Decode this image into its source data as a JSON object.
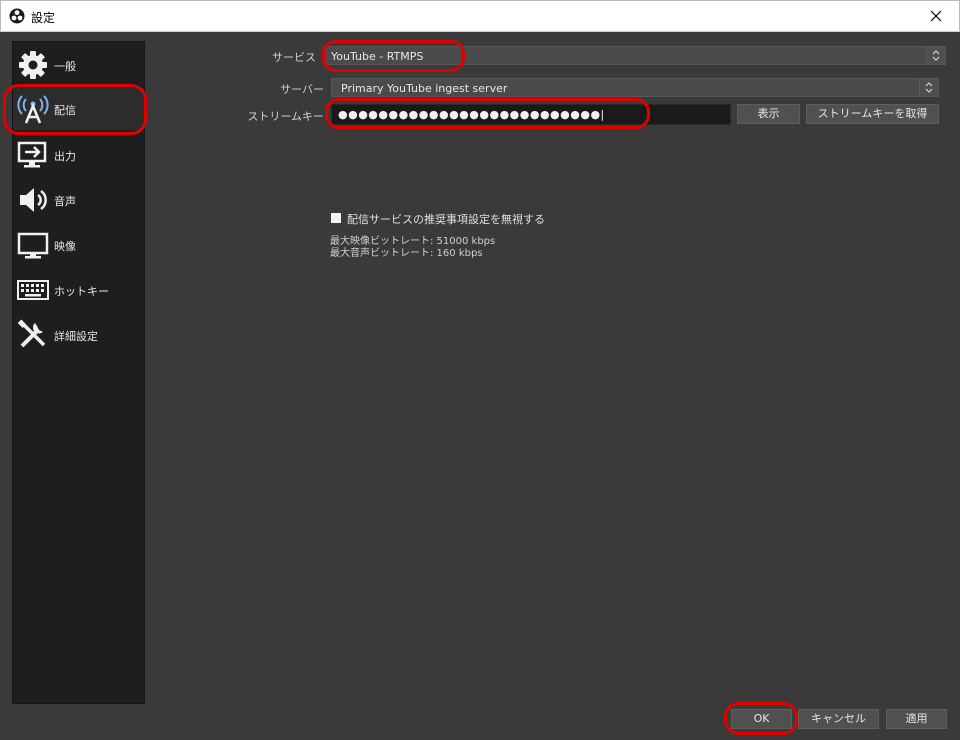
{
  "window": {
    "title": "設定"
  },
  "sidebar": {
    "items": [
      {
        "label": "一般",
        "icon": "gear-icon"
      },
      {
        "label": "配信",
        "icon": "antenna-icon",
        "selected": true
      },
      {
        "label": "出力",
        "icon": "output-icon"
      },
      {
        "label": "音声",
        "icon": "speaker-icon"
      },
      {
        "label": "映像",
        "icon": "monitor-icon"
      },
      {
        "label": "ホットキー",
        "icon": "keyboard-icon"
      },
      {
        "label": "詳細設定",
        "icon": "tools-icon"
      }
    ]
  },
  "stream": {
    "service_label": "サービス",
    "service_value": "YouTube - RTMPS",
    "server_label": "サーバー",
    "server_value": "Primary YouTube ingest server",
    "key_label": "ストリームキー",
    "key_value": "●●●●●●●●●●●●●●●●●●●●●●●●●●|",
    "show_button": "表示",
    "get_key_button": "ストリームキーを取得",
    "ignore_checkbox_label": "配信サービスの推奨事項設定を無視する",
    "ignore_checked": true,
    "max_video_bitrate": "最大映像ビットレート: 51000 kbps",
    "max_audio_bitrate": "最大音声ビットレート: 160 kbps"
  },
  "footer": {
    "ok_button": "OK",
    "cancel_button": "キャンセル",
    "apply_button": "適用"
  },
  "colors": {
    "background": "#3a3a3a",
    "sidebar": "#1e1e1e",
    "highlight": "#e00000"
  }
}
